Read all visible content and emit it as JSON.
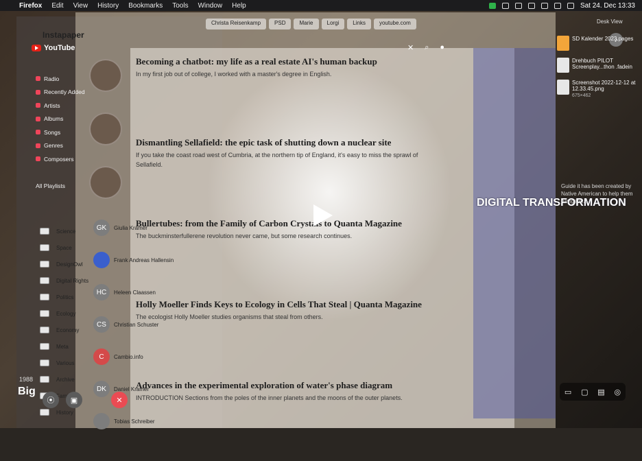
{
  "menubar": {
    "app": "Firefox",
    "items": [
      "Edit",
      "View",
      "History",
      "Bookmarks",
      "Tools",
      "Window",
      "Help"
    ],
    "date_time": "Sat 24. Dec 13:33"
  },
  "browser_tabs": [
    "Christa Reisenkamp",
    "PSD",
    "Marie",
    "Lorgi",
    "Links",
    "youtube.com"
  ],
  "instapaper_title": "Instapaper",
  "youtube": {
    "title": "YouTube"
  },
  "music_sidebar": [
    "Radio",
    "Recently Added",
    "Artists",
    "Albums",
    "Songs",
    "Genres",
    "Composers",
    "All Playlists"
  ],
  "folders": [
    "Science",
    "Space",
    "DesignOwl",
    "Digital Rights",
    "Politics",
    "Ecology",
    "Economy",
    "Meta",
    "Various",
    "Archive",
    "Family",
    "History"
  ],
  "contacts": [
    {
      "initials": "GK",
      "name": "Giulia Kramer",
      "color": "#7d7d7d"
    },
    {
      "initials": "",
      "name": "Frank Andreas Hallensin",
      "color": "#3a5fcd"
    },
    {
      "initials": "HC",
      "name": "Heleen Claassen",
      "color": "#7d7d7d"
    },
    {
      "initials": "CS",
      "name": "Christian Schuster",
      "color": "#7d7d7d"
    },
    {
      "initials": "C",
      "name": "Cambio.info",
      "color": "#d44a4a"
    },
    {
      "initials": "DK",
      "name": "Daniel Kramer",
      "color": "#7d7d7d"
    },
    {
      "initials": "",
      "name": "Tobias Schreiber",
      "color": "#7d7d7d"
    }
  ],
  "articles": [
    {
      "title": "Becoming a chatbot: my life as a real estate AI's human backup",
      "summary": "In my first job out of college, I worked with a master's degree in English."
    },
    {
      "title": "Dismantling Sellafield: the epic task of shutting down a nuclear site",
      "summary": "If you take the coast road west of Cumbria, at the northern tip of England, it's easy to miss the sprawl of Sellafield."
    },
    {
      "title": "Bullertubes: from the Family of Carbon Crystals to Quanta Magazine",
      "summary": "The buckminsterfullerene revolution never came, but some research continues."
    },
    {
      "title": "Holly Moeller Finds Keys to Ecology in Cells That Steal | Quanta Magazine",
      "summary": "The ecologist Holly Moeller studies organisms that steal from others."
    },
    {
      "title": "Advances in the experimental exploration of water's phase diagram",
      "summary": "INTRODUCTION Sections from the poles of the inner planets and the moons of the outer planets."
    }
  ],
  "right_panel_text": "DIGITAL TRANSFORMATION",
  "desktop_files": [
    {
      "name": "SD Kalender 2023.pages",
      "dims": ""
    },
    {
      "name": "Drehbuch PILOT Screenplay...thon .fadein",
      "dims": ""
    },
    {
      "name": "Screenshot 2022-12-12 at 12.33.45.png",
      "dims": "675×462"
    }
  ],
  "desk_view_label": "Desk View",
  "right_note": "Guide it has been created by Native American to help them navigate...",
  "bottom_left": {
    "year": "1988",
    "big_label": "Big"
  },
  "accent": "#e62117"
}
